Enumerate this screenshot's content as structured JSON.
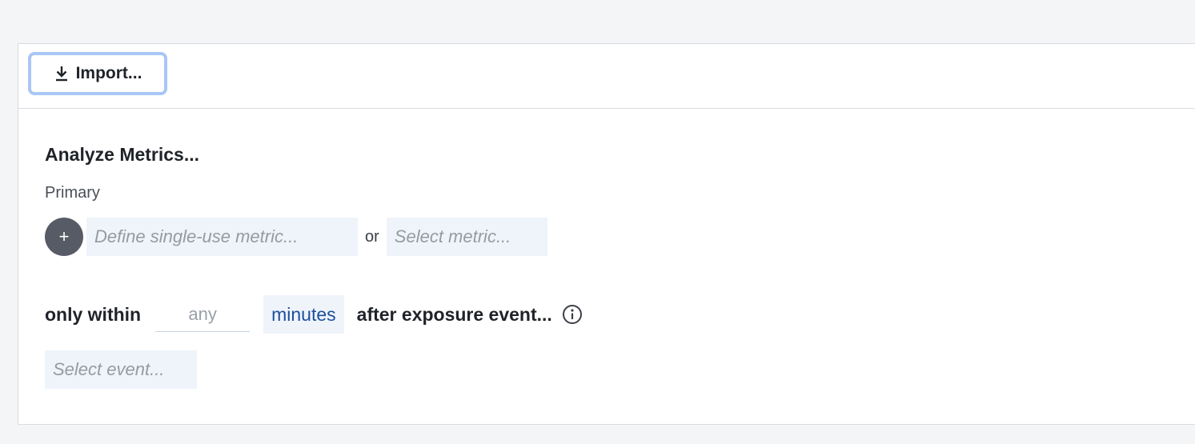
{
  "toolbar": {
    "import_label": "Import...",
    "import_icon": "download-icon"
  },
  "analyze": {
    "title": "Analyze Metrics...",
    "primary_label": "Primary",
    "add_icon": "plus-icon",
    "add_glyph": "+",
    "define_metric_placeholder": "Define single-use metric...",
    "or_text": "or",
    "select_metric_placeholder": "Select metric..."
  },
  "window": {
    "only_within_label": "only within",
    "amount_placeholder": "any",
    "amount_value": "",
    "unit": "minutes",
    "after_label": "after exposure event...",
    "info_icon": "info-icon",
    "select_event_placeholder": "Select event..."
  },
  "colors": {
    "focus_ring": "#a9c6f5",
    "picker_bg": "#eff4fb",
    "unit_text": "#1e4f9c",
    "add_button_bg": "#575b66",
    "page_bg": "#f4f5f7"
  }
}
